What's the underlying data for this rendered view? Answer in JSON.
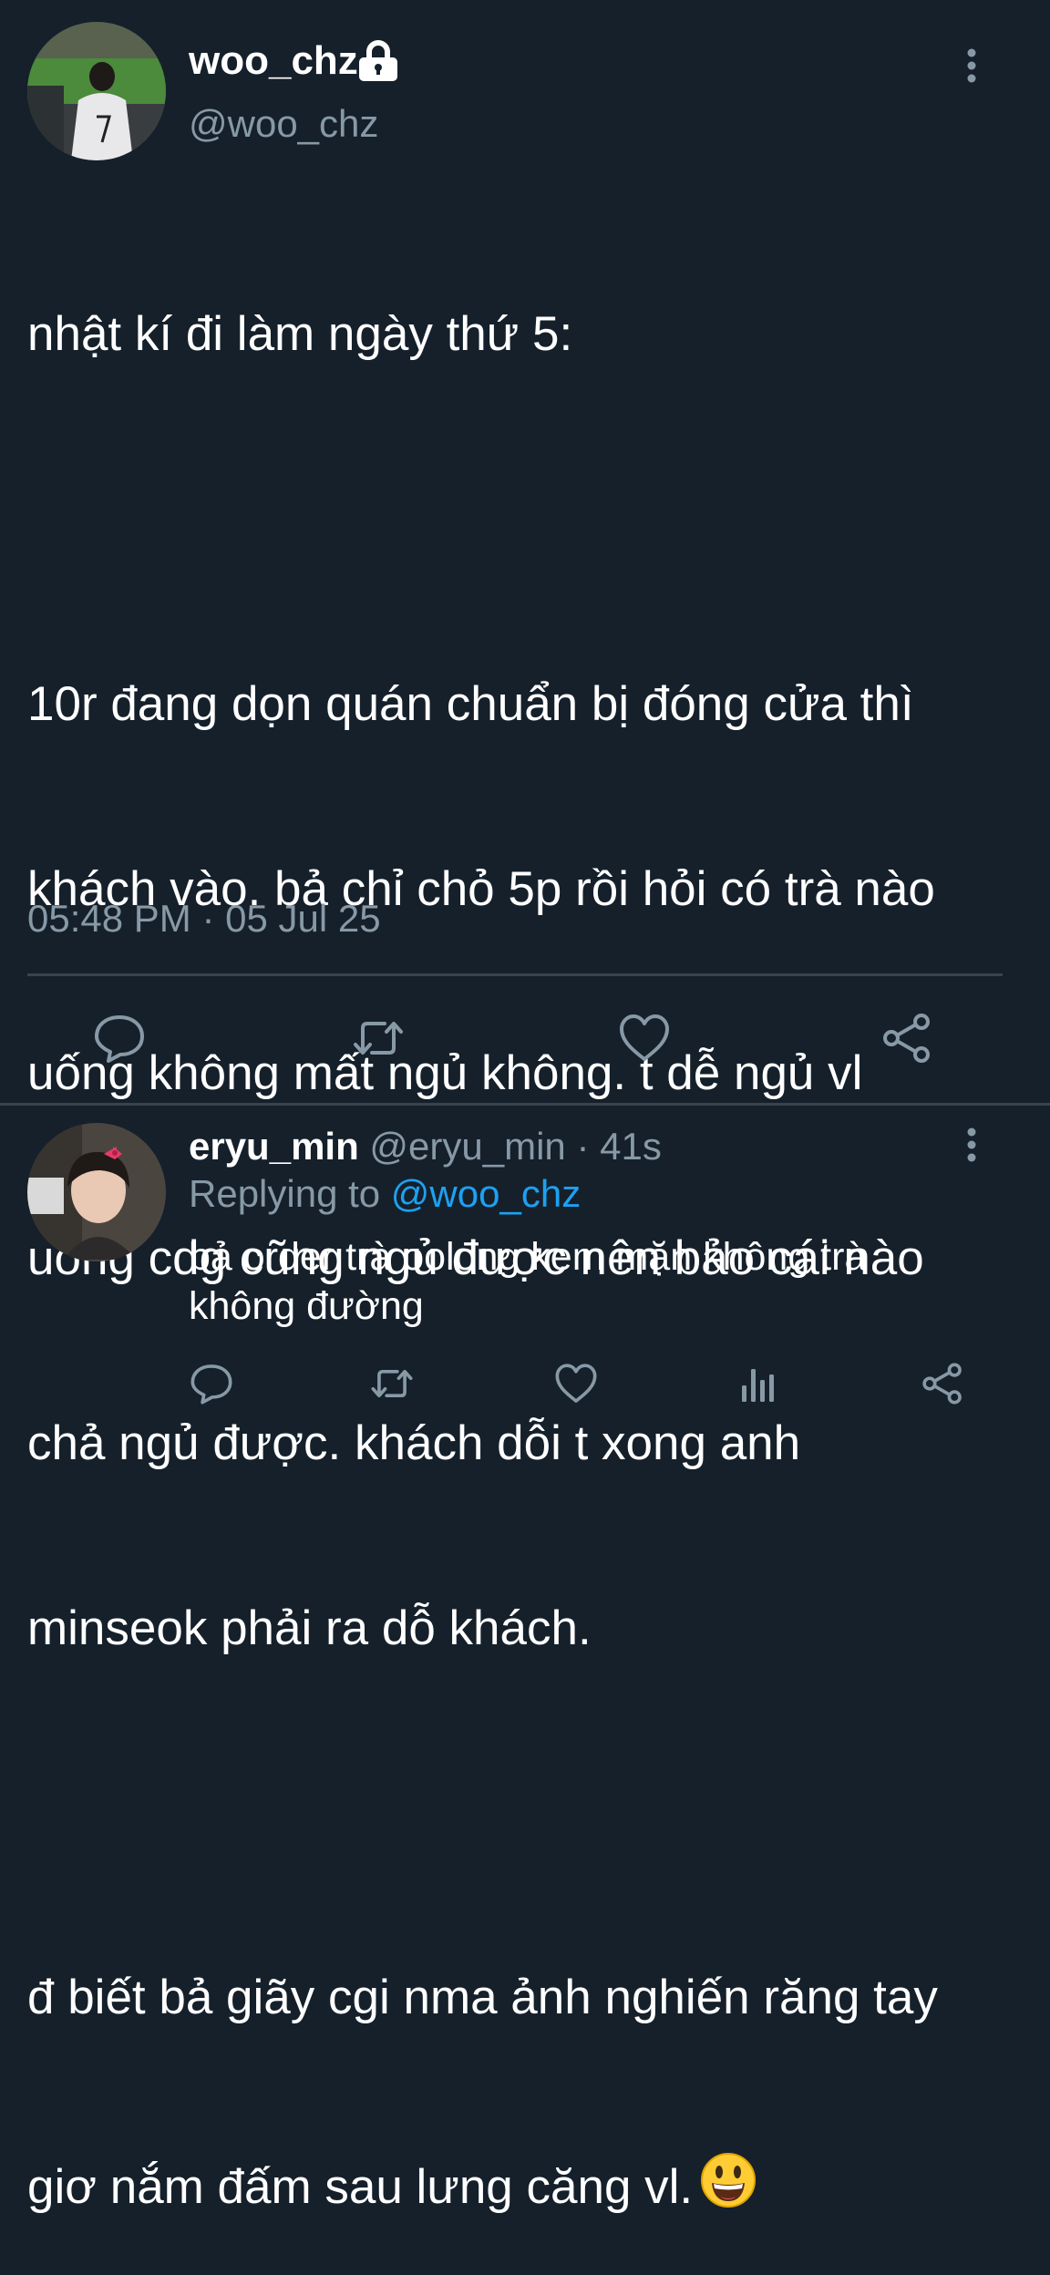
{
  "main_tweet": {
    "display_name": "woo_chz",
    "handle": "@woo_chz",
    "text_lines": [
      "nhật kí đi làm ngày thứ 5:",
      "",
      "10r đang dọn quán chuẩn bị đóng cửa thì",
      "khách vào. bả chỉ chỏ 5p rồi hỏi có trà nào",
      "uống không mất ngủ không. t dễ ngủ vl",
      "uống cdg cũng ngủ được nên bảo cái nào",
      "chả ngủ được. khách dỗi t xong anh",
      "minseok phải ra dỗ khách.",
      "",
      "đ biết bả giãy cgi nma ảnh nghiến răng tay",
      "giơ nắm đấm sau lưng căng vl."
    ],
    "emoji": "smiling-face-with-open-mouth",
    "timestamp": "05:48 PM · 05 Jul 25",
    "icons": {
      "lock": "lock-icon",
      "more": "more-vertical-icon",
      "reply": "reply-icon",
      "retweet": "retweet-icon",
      "like": "heart-icon",
      "share": "share-icon"
    }
  },
  "reply_tweet": {
    "display_name": "eryu_min",
    "handle": "@eryu_min",
    "separator": "·",
    "age": "41s",
    "replying_prefix": "Replying to",
    "replying_to": "@woo_chz",
    "text_lines": [
      "bả order trà oolong kem mặn không trà",
      "không đường"
    ],
    "icons": {
      "more": "more-vertical-icon",
      "reply": "reply-icon",
      "retweet": "retweet-icon",
      "like": "heart-icon",
      "stats": "stats-icon",
      "share": "share-icon"
    }
  },
  "colors": {
    "background": "#15202b",
    "text_primary": "#ffffff",
    "text_secondary": "#8899a6",
    "divider": "#38444d",
    "link": "#1da1f2",
    "icon": "#8899a6"
  }
}
